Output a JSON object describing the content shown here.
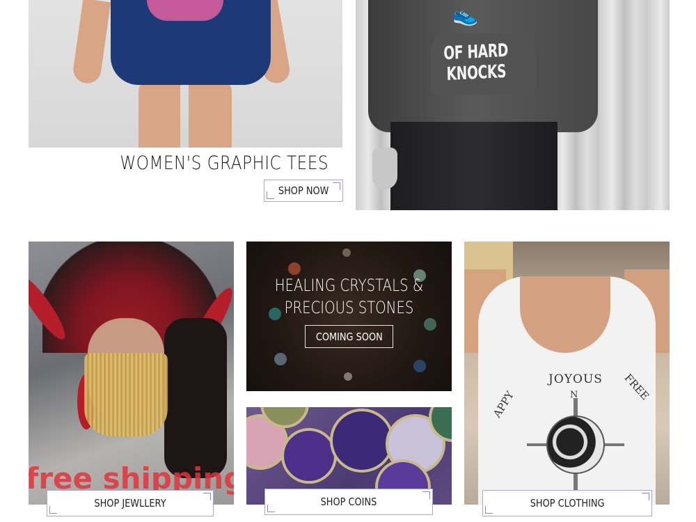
{
  "promo_top": {
    "womens_tees": {
      "title": "WOMEN'S GRAPHIC TEES",
      "button": "SHOP NOW"
    },
    "hoodie": {
      "print_text": "OF HARD KNOCKS"
    }
  },
  "promo_grid": {
    "jewellery": {
      "overlay_text": "free shipping",
      "button": "SHOP JEWLLERY"
    },
    "crystals": {
      "title_line1": "HEALING CRYSTALS &",
      "title_line2": "PRECIOUS STONES",
      "button": "COMING SOON"
    },
    "coins": {
      "button": "SHOP COINS"
    },
    "clothing": {
      "shirt_text": "JOYOUS",
      "shirt_text_left": "APPY",
      "shirt_text_right": "FREE",
      "compass_n": "N",
      "button": "SHOP CLOTHING"
    }
  },
  "colors": {
    "button_border": "#a9a6cf",
    "free_shipping": "#e2343d",
    "shirt_blue": "#1d3a78"
  }
}
